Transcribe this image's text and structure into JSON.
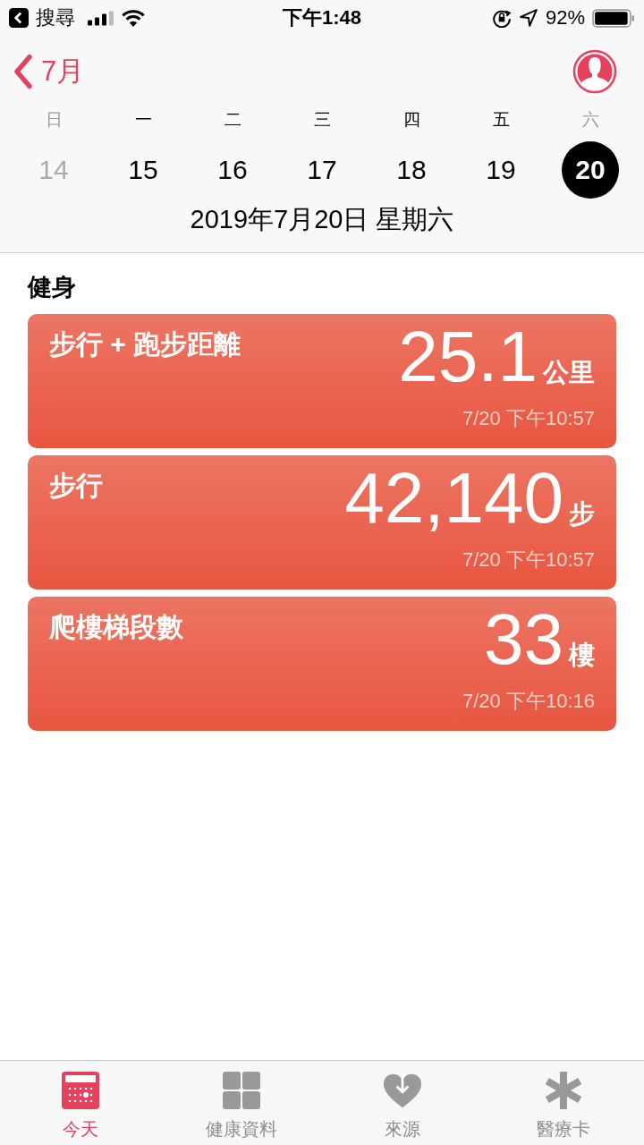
{
  "status_bar": {
    "back_label": "搜尋",
    "time": "下午1:48",
    "battery": "92%"
  },
  "nav": {
    "back_label": "7月"
  },
  "week": [
    {
      "weekday": "日",
      "date": "14",
      "weekend": true,
      "selected": false
    },
    {
      "weekday": "一",
      "date": "15",
      "weekend": false,
      "selected": false
    },
    {
      "weekday": "二",
      "date": "16",
      "weekend": false,
      "selected": false
    },
    {
      "weekday": "三",
      "date": "17",
      "weekend": false,
      "selected": false
    },
    {
      "weekday": "四",
      "date": "18",
      "weekend": false,
      "selected": false
    },
    {
      "weekday": "五",
      "date": "19",
      "weekend": false,
      "selected": false
    },
    {
      "weekday": "六",
      "date": "20",
      "weekend": true,
      "selected": true
    }
  ],
  "selected_date": "2019年7月20日 星期六",
  "section_title": "健身",
  "cards": [
    {
      "title": "步行 + 跑步距離",
      "value": "25.1",
      "unit": "公里",
      "timestamp": "7/20 下午10:57"
    },
    {
      "title": "步行",
      "value": "42,140",
      "unit": "步",
      "timestamp": "7/20 下午10:57"
    },
    {
      "title": "爬樓梯段數",
      "value": "33",
      "unit": "樓",
      "timestamp": "7/20 下午10:16"
    }
  ],
  "tabs": [
    {
      "label": "今天",
      "kind": "today",
      "selected": true
    },
    {
      "label": "健康資料",
      "kind": "grid",
      "selected": false
    },
    {
      "label": "來源",
      "kind": "heart",
      "selected": false
    },
    {
      "label": "醫療卡",
      "kind": "asterisk",
      "selected": false
    }
  ]
}
